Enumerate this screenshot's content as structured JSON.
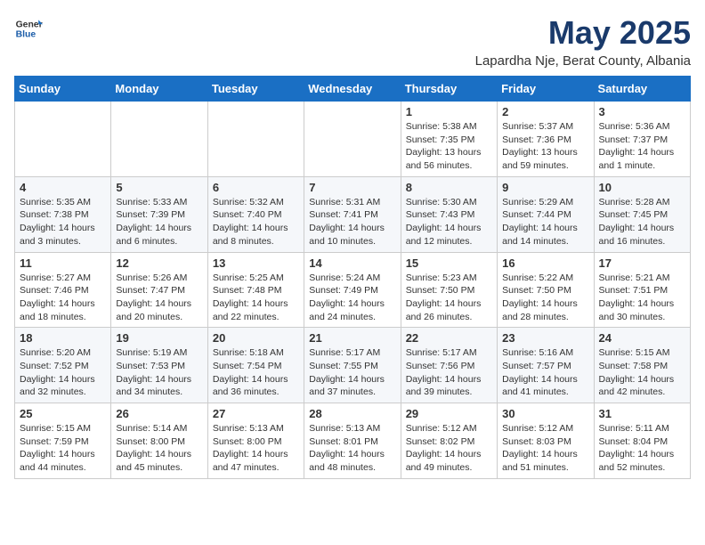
{
  "logo": {
    "general": "General",
    "blue": "Blue"
  },
  "title": "May 2025",
  "location": "Lapardha Nje, Berat County, Albania",
  "days_of_week": [
    "Sunday",
    "Monday",
    "Tuesday",
    "Wednesday",
    "Thursday",
    "Friday",
    "Saturday"
  ],
  "weeks": [
    [
      {
        "day": "",
        "info": ""
      },
      {
        "day": "",
        "info": ""
      },
      {
        "day": "",
        "info": ""
      },
      {
        "day": "",
        "info": ""
      },
      {
        "day": "1",
        "info": "Sunrise: 5:38 AM\nSunset: 7:35 PM\nDaylight: 13 hours and 56 minutes."
      },
      {
        "day": "2",
        "info": "Sunrise: 5:37 AM\nSunset: 7:36 PM\nDaylight: 13 hours and 59 minutes."
      },
      {
        "day": "3",
        "info": "Sunrise: 5:36 AM\nSunset: 7:37 PM\nDaylight: 14 hours and 1 minute."
      }
    ],
    [
      {
        "day": "4",
        "info": "Sunrise: 5:35 AM\nSunset: 7:38 PM\nDaylight: 14 hours and 3 minutes."
      },
      {
        "day": "5",
        "info": "Sunrise: 5:33 AM\nSunset: 7:39 PM\nDaylight: 14 hours and 6 minutes."
      },
      {
        "day": "6",
        "info": "Sunrise: 5:32 AM\nSunset: 7:40 PM\nDaylight: 14 hours and 8 minutes."
      },
      {
        "day": "7",
        "info": "Sunrise: 5:31 AM\nSunset: 7:41 PM\nDaylight: 14 hours and 10 minutes."
      },
      {
        "day": "8",
        "info": "Sunrise: 5:30 AM\nSunset: 7:43 PM\nDaylight: 14 hours and 12 minutes."
      },
      {
        "day": "9",
        "info": "Sunrise: 5:29 AM\nSunset: 7:44 PM\nDaylight: 14 hours and 14 minutes."
      },
      {
        "day": "10",
        "info": "Sunrise: 5:28 AM\nSunset: 7:45 PM\nDaylight: 14 hours and 16 minutes."
      }
    ],
    [
      {
        "day": "11",
        "info": "Sunrise: 5:27 AM\nSunset: 7:46 PM\nDaylight: 14 hours and 18 minutes."
      },
      {
        "day": "12",
        "info": "Sunrise: 5:26 AM\nSunset: 7:47 PM\nDaylight: 14 hours and 20 minutes."
      },
      {
        "day": "13",
        "info": "Sunrise: 5:25 AM\nSunset: 7:48 PM\nDaylight: 14 hours and 22 minutes."
      },
      {
        "day": "14",
        "info": "Sunrise: 5:24 AM\nSunset: 7:49 PM\nDaylight: 14 hours and 24 minutes."
      },
      {
        "day": "15",
        "info": "Sunrise: 5:23 AM\nSunset: 7:50 PM\nDaylight: 14 hours and 26 minutes."
      },
      {
        "day": "16",
        "info": "Sunrise: 5:22 AM\nSunset: 7:50 PM\nDaylight: 14 hours and 28 minutes."
      },
      {
        "day": "17",
        "info": "Sunrise: 5:21 AM\nSunset: 7:51 PM\nDaylight: 14 hours and 30 minutes."
      }
    ],
    [
      {
        "day": "18",
        "info": "Sunrise: 5:20 AM\nSunset: 7:52 PM\nDaylight: 14 hours and 32 minutes."
      },
      {
        "day": "19",
        "info": "Sunrise: 5:19 AM\nSunset: 7:53 PM\nDaylight: 14 hours and 34 minutes."
      },
      {
        "day": "20",
        "info": "Sunrise: 5:18 AM\nSunset: 7:54 PM\nDaylight: 14 hours and 36 minutes."
      },
      {
        "day": "21",
        "info": "Sunrise: 5:17 AM\nSunset: 7:55 PM\nDaylight: 14 hours and 37 minutes."
      },
      {
        "day": "22",
        "info": "Sunrise: 5:17 AM\nSunset: 7:56 PM\nDaylight: 14 hours and 39 minutes."
      },
      {
        "day": "23",
        "info": "Sunrise: 5:16 AM\nSunset: 7:57 PM\nDaylight: 14 hours and 41 minutes."
      },
      {
        "day": "24",
        "info": "Sunrise: 5:15 AM\nSunset: 7:58 PM\nDaylight: 14 hours and 42 minutes."
      }
    ],
    [
      {
        "day": "25",
        "info": "Sunrise: 5:15 AM\nSunset: 7:59 PM\nDaylight: 14 hours and 44 minutes."
      },
      {
        "day": "26",
        "info": "Sunrise: 5:14 AM\nSunset: 8:00 PM\nDaylight: 14 hours and 45 minutes."
      },
      {
        "day": "27",
        "info": "Sunrise: 5:13 AM\nSunset: 8:00 PM\nDaylight: 14 hours and 47 minutes."
      },
      {
        "day": "28",
        "info": "Sunrise: 5:13 AM\nSunset: 8:01 PM\nDaylight: 14 hours and 48 minutes."
      },
      {
        "day": "29",
        "info": "Sunrise: 5:12 AM\nSunset: 8:02 PM\nDaylight: 14 hours and 49 minutes."
      },
      {
        "day": "30",
        "info": "Sunrise: 5:12 AM\nSunset: 8:03 PM\nDaylight: 14 hours and 51 minutes."
      },
      {
        "day": "31",
        "info": "Sunrise: 5:11 AM\nSunset: 8:04 PM\nDaylight: 14 hours and 52 minutes."
      }
    ]
  ]
}
